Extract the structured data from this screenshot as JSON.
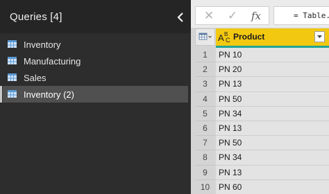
{
  "queries": {
    "title": "Queries [4]",
    "items": [
      {
        "label": "Inventory",
        "selected": false
      },
      {
        "label": "Manufacturing",
        "selected": false
      },
      {
        "label": "Sales",
        "selected": false
      },
      {
        "label": "Inventory (2)",
        "selected": true
      }
    ]
  },
  "formula_bar": {
    "cancel_icon": "✕",
    "commit_icon": "✓",
    "fx_label": "fx",
    "formula_text": "= Table."
  },
  "grid": {
    "column": {
      "name": "Product",
      "type_icon": "text-type-icon"
    },
    "rows": [
      {
        "num": "1",
        "value": "PN 10"
      },
      {
        "num": "2",
        "value": "PN 20"
      },
      {
        "num": "3",
        "value": "PN 13"
      },
      {
        "num": "4",
        "value": "PN 50"
      },
      {
        "num": "5",
        "value": "PN 34"
      },
      {
        "num": "6",
        "value": "PN 13"
      },
      {
        "num": "7",
        "value": "PN 50"
      },
      {
        "num": "8",
        "value": "PN 34"
      },
      {
        "num": "9",
        "value": "PN 13"
      },
      {
        "num": "10",
        "value": "PN 60"
      }
    ]
  },
  "colors": {
    "column_header": "#f2c811",
    "column_quality_bar": "#21a495",
    "pane_bg": "#2d2d2d"
  }
}
